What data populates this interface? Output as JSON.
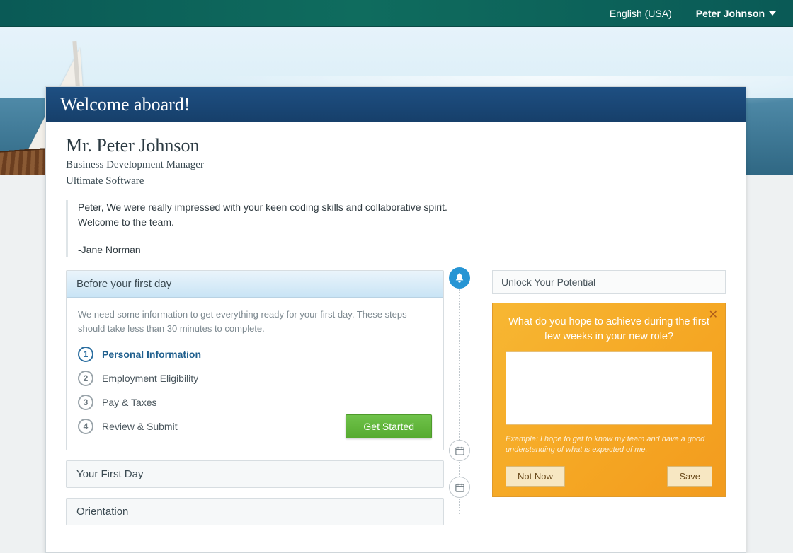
{
  "topbar": {
    "language": "English (USA)",
    "user": "Peter Johnson"
  },
  "banner_title": "Welcome aboard!",
  "profile": {
    "name": "Mr. Peter Johnson",
    "title": "Business Development Manager",
    "company": "Ultimate Software"
  },
  "welcome_message": {
    "line1": "Peter, We were really impressed with your keen coding skills and collaborative spirit.",
    "line2": "Welcome to the team.",
    "author": "-Jane Norman"
  },
  "before": {
    "header": "Before your first day",
    "desc": "We need some information to get everything ready for your first day. These steps should take less than 30 minutes to complete.",
    "steps": [
      {
        "n": "1",
        "label": "Personal Information"
      },
      {
        "n": "2",
        "label": "Employment Eligibility"
      },
      {
        "n": "3",
        "label": "Pay & Taxes"
      },
      {
        "n": "4",
        "label": "Review & Submit"
      }
    ],
    "cta": "Get Started"
  },
  "sections": {
    "first_day": "Your First Day",
    "orientation": "Orientation"
  },
  "potential": {
    "header": "Unlock Your Potential",
    "question": "What do you hope to achieve during the first few weeks in your new role?",
    "hint": "Example: I hope to get to know my team and have a good understanding of what is expected of me.",
    "not_now": "Not Now",
    "save": "Save"
  }
}
